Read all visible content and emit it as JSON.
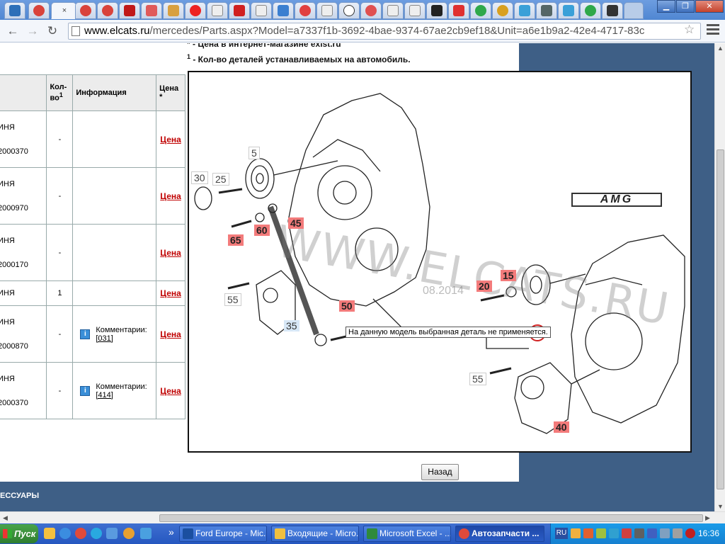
{
  "browser": {
    "url_host": "www.elcats.ru",
    "url_path": "/mercedes/Parts.aspx?Model=a7337f1b-3692-4bae-9374-67ae2cb9ef18&Unit=a6e1b9a2-42e4-4717-83c",
    "tab_close": "×"
  },
  "notes": {
    "n1_mark": "*",
    "n1_text": " - Цена в интернет-магазине exist.ru",
    "n2_mark": "1",
    "n2_text": " - Кол-во деталей устанавливаемых на автомобиль."
  },
  "table": {
    "headers": {
      "qty": "Кол-во",
      "qty_sup": "1",
      "info": "Информация",
      "price": "Цена",
      "price_mark": "*"
    },
    "rows": [
      {
        "name": "ИНЯ",
        "code": "2000370",
        "qty": "-",
        "comment": "",
        "comment_code": "",
        "price": "Цена"
      },
      {
        "name": "ИНЯ",
        "code": "2000970",
        "qty": "-",
        "comment": "",
        "comment_code": "",
        "price": "Цена"
      },
      {
        "name": "ИНЯ",
        "code": "2000170",
        "qty": "-",
        "comment": "",
        "comment_code": "",
        "price": "Цена"
      },
      {
        "name": "ИНЯ",
        "code": "",
        "qty": "1",
        "comment": "",
        "comment_code": "",
        "price": "Цена"
      },
      {
        "name": "ИНЯ",
        "code": "2000870",
        "qty": "-",
        "comment": "Комментарии:",
        "comment_code": "[031]",
        "price": "Цена"
      },
      {
        "name": "ИНЯ",
        "code": "2000370",
        "qty": "-",
        "comment": "Комментарии:",
        "comment_code": "[414]",
        "price": "Цена"
      }
    ]
  },
  "diagram": {
    "labels": [
      "30",
      "25",
      "5",
      "65",
      "60",
      "45",
      "55",
      "35",
      "50",
      "20",
      "15",
      "55",
      "40"
    ],
    "watermark": "WWW.ELCATS.RU",
    "watermark_date": "08.2014",
    "brand": "AMG",
    "tooltip": "На данную модель выбранная деталь не применяется."
  },
  "back_button": "Назад",
  "footer_text": "ЕССУАРЫ",
  "taskbar": {
    "start": "Пуск",
    "tasks": [
      "Ford Europe - Mic...",
      "Входящие - Micro...",
      "Microsoft Excel - ...",
      "Автозапчасти ..."
    ],
    "more": "»",
    "lang": "RU",
    "clock": "16:36"
  }
}
